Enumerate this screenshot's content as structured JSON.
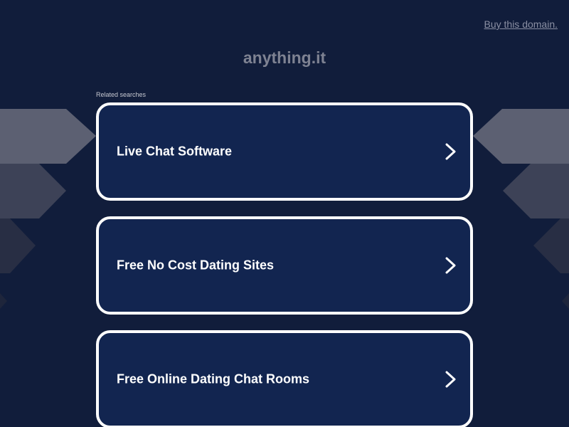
{
  "header": {
    "buy_link": "Buy this domain."
  },
  "site": {
    "domain": "anything.it"
  },
  "related": {
    "label": "Related searches",
    "items": [
      {
        "label": "Live Chat Software",
        "icon": "chevron-right-icon"
      },
      {
        "label": "Free No Cost Dating Sites",
        "icon": "chevron-right-icon"
      },
      {
        "label": "Free Online Dating Chat Rooms",
        "icon": "chevron-right-icon"
      }
    ]
  },
  "colors": {
    "background": "#111d3b",
    "card": "#122550",
    "card_border": "#ffffff",
    "title": "#7e8292",
    "link": "#8a8fa3"
  }
}
